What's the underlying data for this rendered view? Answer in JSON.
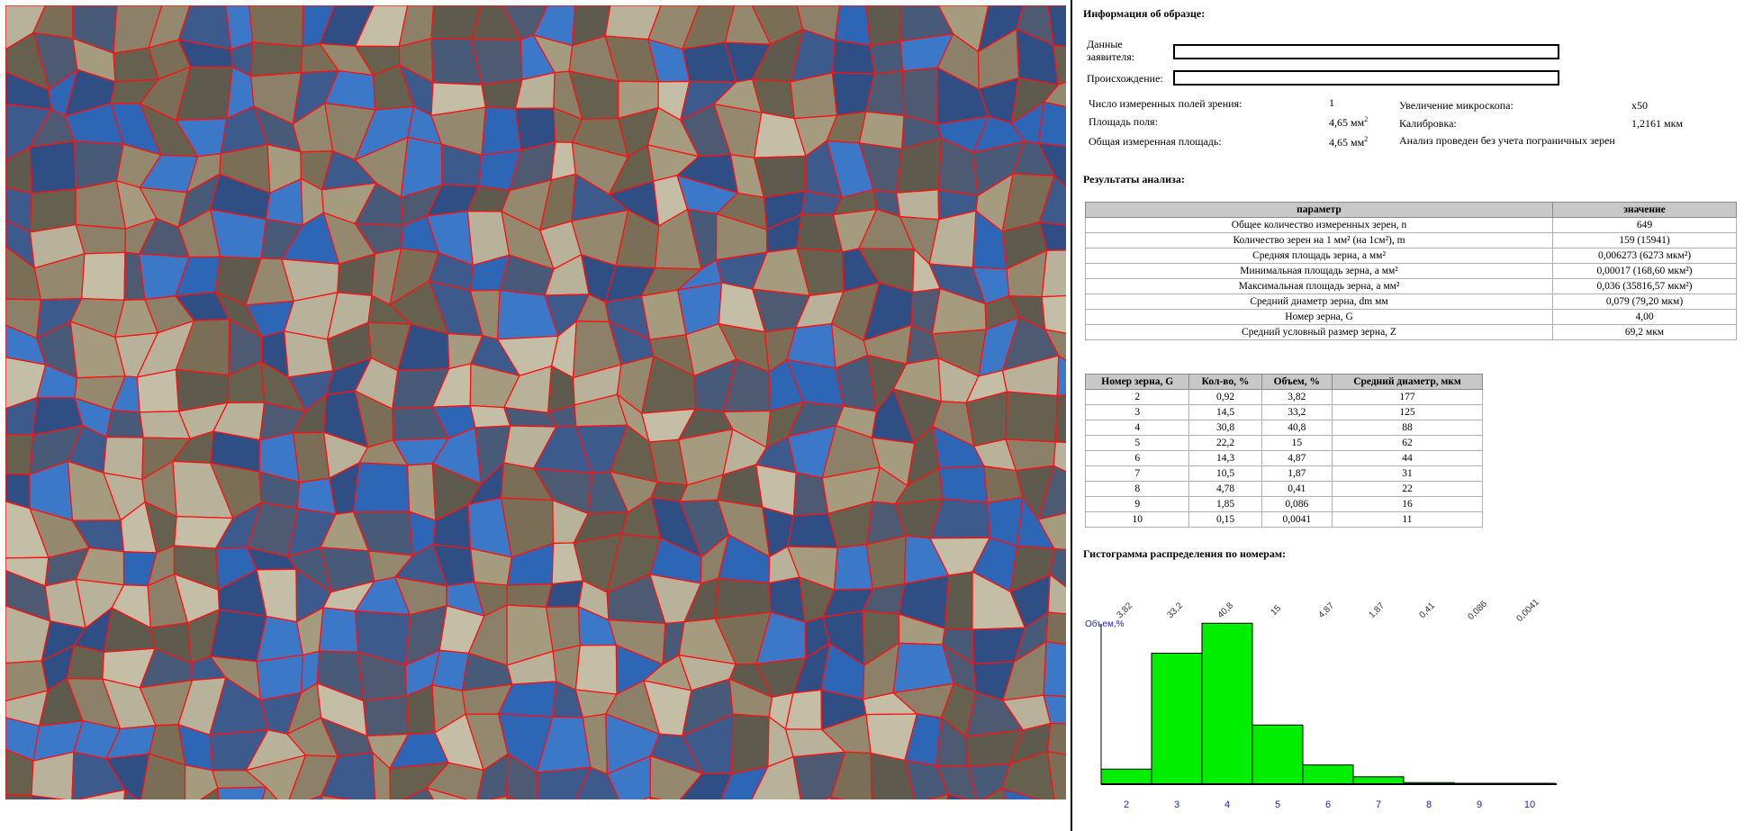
{
  "sample_info": {
    "heading": "Информация об образце:",
    "applicant_label_line1": "Данные",
    "applicant_label_line2": "заявителя:",
    "applicant_value": "",
    "origin_label": "Происхождение:",
    "origin_value": ""
  },
  "measurement": {
    "fields_label": "Число измеренных полей зрения:",
    "fields_value": "1",
    "area_label": "Площадь поля:",
    "area_value": "4,65 мм",
    "total_area_label": "Общая измеренная площадь:",
    "total_area_value": "4,65 мм",
    "squared_suffix": "2",
    "magnification_label": "Увеличение микроскопа:",
    "magnification_value": "x50",
    "calibration_label": "Калибровка:",
    "calibration_value": "1,2161 мкм",
    "note": "Анализ проведен без учета пограничных зерен"
  },
  "results": {
    "heading": "Результаты анализа:",
    "col_param": "параметр",
    "col_value": "значение",
    "rows": [
      {
        "param": "Общее количество измеренных зерен, n",
        "value": "649"
      },
      {
        "param": "Количество зерен на 1 мм² (на 1см²), m",
        "value": "159 (15941)"
      },
      {
        "param": "Средняя площадь зерна, a мм²",
        "value": "0,006273 (6273 мкм²)"
      },
      {
        "param": "Минимальная площадь зерна, a мм²",
        "value": "0,00017 (168,60 мкм²)"
      },
      {
        "param": "Максимальная площадь зерна, a мм²",
        "value": "0,036 (35816,57 мкм²)"
      },
      {
        "param": "Средний диаметр зерна, dm мм",
        "value": "0,079 (79,20 мкм)"
      },
      {
        "param": "Номер зерна, G",
        "value": "4,00"
      },
      {
        "param": "Средний условный размер зерна, Z",
        "value": "69,2 мкм"
      }
    ]
  },
  "distribution": {
    "headers": [
      "Номер зерна, G",
      "Кол-во, %",
      "Объем, %",
      "Средний диаметр, мкм"
    ],
    "rows": [
      [
        "2",
        "0,92",
        "3,82",
        "177"
      ],
      [
        "3",
        "14,5",
        "33,2",
        "125"
      ],
      [
        "4",
        "30,8",
        "40,8",
        "88"
      ],
      [
        "5",
        "22,2",
        "15",
        "62"
      ],
      [
        "6",
        "14,3",
        "4,87",
        "44"
      ],
      [
        "7",
        "10,5",
        "1,87",
        "31"
      ],
      [
        "8",
        "4,78",
        "0,41",
        "22"
      ],
      [
        "9",
        "1,85",
        "0,086",
        "16"
      ],
      [
        "10",
        "0,15",
        "0,0041",
        "11"
      ]
    ]
  },
  "histogram": {
    "heading": "Гистограмма распределения по номерам:"
  },
  "chart_data": {
    "type": "bar",
    "categories": [
      "2",
      "3",
      "4",
      "5",
      "6",
      "7",
      "8",
      "9",
      "10"
    ],
    "values": [
      3.82,
      33.2,
      40.8,
      15,
      4.87,
      1.87,
      0.41,
      0.086,
      0.0041
    ],
    "value_labels": [
      "3,82",
      "33,2",
      "40,8",
      "15",
      "4,87",
      "1,87",
      "0,41",
      "0,086",
      "0,0041"
    ],
    "ylabel": "Объем,%",
    "bar_color": "#00ee00",
    "label_color": "#2020cc"
  },
  "image": {
    "boundary_color": "#ff1010",
    "grain_colors": [
      "#3c5a8c",
      "#2f4f84",
      "#4e5a72",
      "#5e5a4e",
      "#7a6e56",
      "#8c8068",
      "#a59c80",
      "#b8b29a",
      "#c4bea6",
      "#2d66b4",
      "#3b78c8",
      "#475a78",
      "#66604f",
      "#94896e"
    ]
  }
}
